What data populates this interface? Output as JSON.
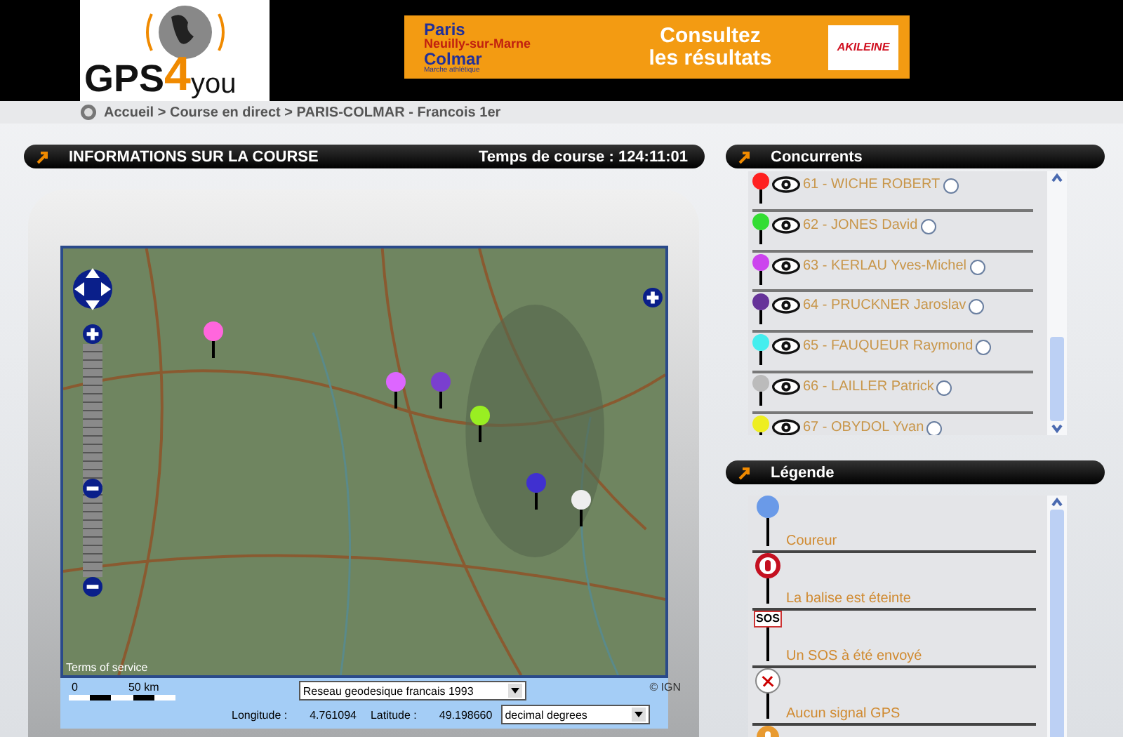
{
  "header": {
    "logo": {
      "text_a": "GPS",
      "text_b": "4",
      "text_c": "you"
    },
    "banner": {
      "line_1": "Paris",
      "line_2": "Neuilly-sur-Marne",
      "line_3": "Colmar",
      "tagline": "Marche athlétique",
      "cta_1": "Consultez",
      "cta_2": "les résultats",
      "sponsor": "AKILEINE"
    }
  },
  "breadcrumb": "Accueil > Course en direct > PARIS-COLMAR - Francois 1er",
  "course_panel": {
    "title": "INFORMATIONS SUR LA COURSE",
    "race_time": "Temps de course : 124:11:01",
    "map": {
      "zoom": {
        "level": 0.38
      },
      "terms": "Terms of service",
      "scale_zero": "0",
      "scale_label": "50 km",
      "projection": "Reseau geodesique francais 1993",
      "credit": "© IGN",
      "longitude_label": "Longitude :",
      "longitude": "4.761094",
      "latitude_label": "Latitude :",
      "latitude": "49.198660",
      "units": "decimal degrees"
    }
  },
  "competitors": {
    "title": "Concurrents",
    "items": [
      {
        "label": "61 - WICHE ROBERT",
        "color": "#ff2020",
        "selected": false
      },
      {
        "label": "62 - JONES David",
        "color": "#33dd33",
        "selected": false
      },
      {
        "label": "63 - KERLAU Yves-Michel",
        "color": "#cc44ee",
        "selected": false
      },
      {
        "label": "64 - PRUCKNER Jaroslav",
        "color": "#663399",
        "selected": false
      },
      {
        "label": "65 - FAUQUEUR Raymond",
        "color": "#44eeee",
        "selected": false
      },
      {
        "label": "66 - LAILLER Patrick",
        "color": "#bbbbbb",
        "selected": false
      },
      {
        "label": "67 - OBYDOL Yvan",
        "color": "#eeee22",
        "selected": false
      }
    ]
  },
  "legend": {
    "title": "Légende",
    "items": [
      {
        "kind": "runner",
        "label": "Coureur"
      },
      {
        "kind": "off",
        "label": "La balise est éteinte"
      },
      {
        "kind": "sos",
        "label": "Un SOS à été envoyé",
        "icon_text": "SOS"
      },
      {
        "kind": "nosignal",
        "label": "Aucun signal GPS"
      },
      {
        "kind": "warning"
      }
    ]
  }
}
